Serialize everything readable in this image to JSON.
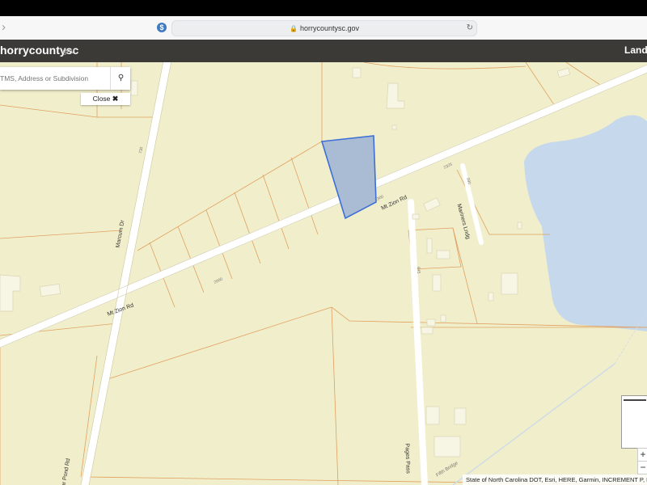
{
  "browser": {
    "url": "horrycountysc.gov",
    "site_icon": "$",
    "back_icon": "chevron-left-icon",
    "reload_icon": "reload-icon"
  },
  "header": {
    "brand": "horrycountysc",
    "brand_suffix": ".gov",
    "right_text": "Land"
  },
  "search": {
    "placeholder": "TMS, Address or Subdivision",
    "button_icon": "search-icon",
    "close_label": "Close",
    "close_icon": "close-icon"
  },
  "map": {
    "roads": {
      "mt_zion_1": "Mt Zion Rd",
      "mt_zion_2": "Mt Zion Rd",
      "marcum": "Marcum Dr",
      "clear_pond": "Clear Pond Rd",
      "pages_pass": "Pages Pass",
      "mariners": "Mariners Lndg",
      "fifth_bridge": "Fifth Bridge"
    },
    "address_numbers": {
      "n1": "2325",
      "n2": "2300",
      "n3": "2000",
      "n4": "730",
      "n5": "645",
      "n6": "990"
    },
    "colors": {
      "land": "#f1efcb",
      "parcel_line": "#e0a060",
      "road": "#ffffff",
      "water": "#c5d8ec",
      "selected_fill": "#a9bcd4",
      "selected_stroke": "#3d6fd6"
    }
  },
  "zoom": {
    "in": "+",
    "out": "−"
  },
  "attribution": "State of North Carolina DOT, Esri, HERE, Garmin, INCREMENT P, NGA, USGS"
}
